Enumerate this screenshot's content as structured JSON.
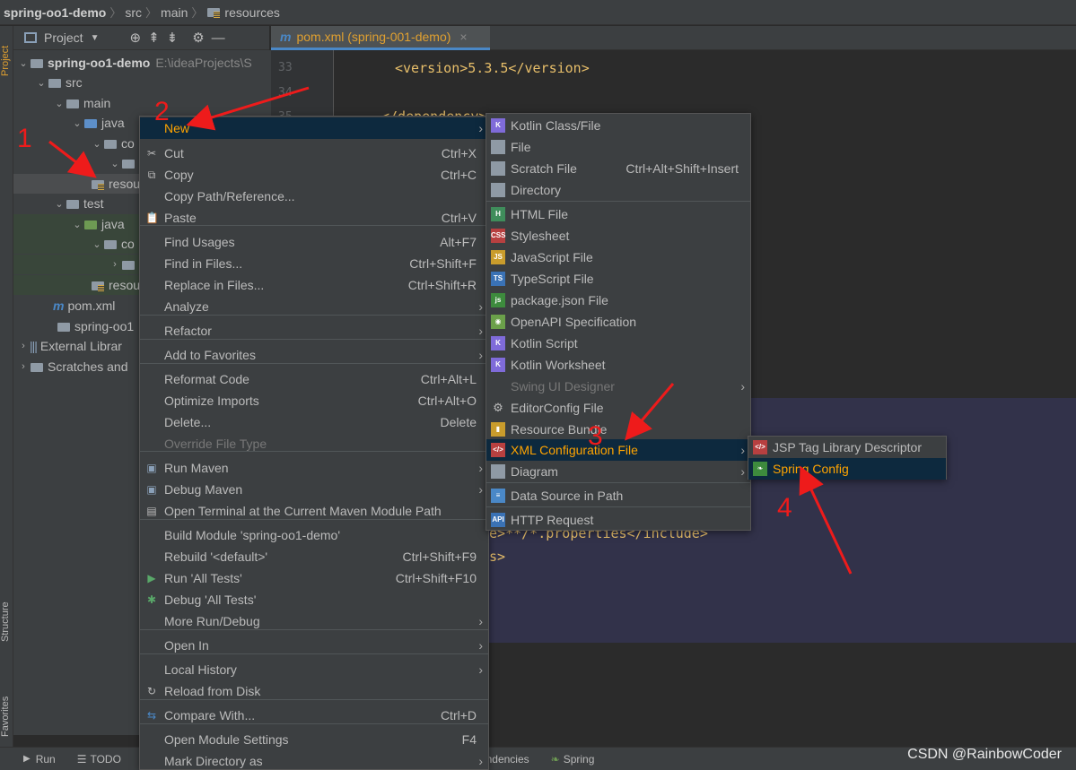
{
  "breadcrumb": {
    "project": "spring-oo1-demo",
    "src": "src",
    "main": "main",
    "resources": "resources"
  },
  "left_strip": {
    "project": "Project",
    "structure": "Structure",
    "favorites": "Favorites"
  },
  "project_toolbar": {
    "label": "Project",
    "caret": "▼"
  },
  "tree": {
    "root": "spring-oo1-demo",
    "root_path": "E:\\ideaProjects\\S",
    "src": "src",
    "main": "main",
    "java": "java",
    "co1": "co",
    "resources": "resou",
    "test": "test",
    "test_java": "java",
    "co2": "co",
    "test_resources": "resou",
    "pom": "pom.xml",
    "iml": "spring-oo1",
    "external": "External Librar",
    "scratches": "Scratches and"
  },
  "editor": {
    "tab_label": "pom.xml (spring-001-demo)",
    "lines": [
      "33",
      "34",
      "35"
    ],
    "line33": "<version>5.3.5</version>",
    "line35_partial": "</dependency>",
    "frag1": "de>**/*.properties</include>",
    "frag2": "es>"
  },
  "context_menu": {
    "items": [
      {
        "label": "New",
        "shortcut": "",
        "submenu": true
      },
      {
        "label": "Cut",
        "shortcut": "Ctrl+X"
      },
      {
        "label": "Copy",
        "shortcut": "Ctrl+C"
      },
      {
        "label": "Copy Path/Reference...",
        "shortcut": ""
      },
      {
        "label": "Paste",
        "shortcut": "Ctrl+V"
      },
      {
        "label": "Find Usages",
        "shortcut": "Alt+F7"
      },
      {
        "label": "Find in Files...",
        "shortcut": "Ctrl+Shift+F"
      },
      {
        "label": "Replace in Files...",
        "shortcut": "Ctrl+Shift+R"
      },
      {
        "label": "Analyze",
        "shortcut": "",
        "submenu": true
      },
      {
        "label": "Refactor",
        "shortcut": "",
        "submenu": true
      },
      {
        "label": "Add to Favorites",
        "shortcut": "",
        "submenu": true
      },
      {
        "label": "Reformat Code",
        "shortcut": "Ctrl+Alt+L"
      },
      {
        "label": "Optimize Imports",
        "shortcut": "Ctrl+Alt+O"
      },
      {
        "label": "Delete...",
        "shortcut": "Delete"
      },
      {
        "label": "Override File Type",
        "shortcut": ""
      },
      {
        "label": "Run Maven",
        "shortcut": "",
        "submenu": true
      },
      {
        "label": "Debug Maven",
        "shortcut": "",
        "submenu": true
      },
      {
        "label": "Open Terminal at the Current Maven Module Path",
        "shortcut": ""
      },
      {
        "label": "Build Module 'spring-oo1-demo'",
        "shortcut": ""
      },
      {
        "label": "Rebuild '<default>'",
        "shortcut": "Ctrl+Shift+F9"
      },
      {
        "label": "Run 'All Tests'",
        "shortcut": "Ctrl+Shift+F10"
      },
      {
        "label": "Debug 'All Tests'",
        "shortcut": ""
      },
      {
        "label": "More Run/Debug",
        "shortcut": "",
        "submenu": true
      },
      {
        "label": "Open In",
        "shortcut": "",
        "submenu": true
      },
      {
        "label": "Local History",
        "shortcut": "",
        "submenu": true
      },
      {
        "label": "Reload from Disk",
        "shortcut": ""
      },
      {
        "label": "Compare With...",
        "shortcut": "Ctrl+D"
      },
      {
        "label": "Open Module Settings",
        "shortcut": "F4"
      },
      {
        "label": "Mark Directory as",
        "shortcut": "",
        "submenu": true
      }
    ]
  },
  "new_submenu": {
    "items": [
      {
        "label": "Kotlin Class/File",
        "shortcut": ""
      },
      {
        "label": "File",
        "shortcut": ""
      },
      {
        "label": "Scratch File",
        "shortcut": "Ctrl+Alt+Shift+Insert"
      },
      {
        "label": "Directory",
        "shortcut": ""
      },
      {
        "label": "HTML File",
        "shortcut": ""
      },
      {
        "label": "Stylesheet",
        "shortcut": ""
      },
      {
        "label": "JavaScript File",
        "shortcut": ""
      },
      {
        "label": "TypeScript File",
        "shortcut": ""
      },
      {
        "label": "package.json File",
        "shortcut": ""
      },
      {
        "label": "OpenAPI Specification",
        "shortcut": ""
      },
      {
        "label": "Kotlin Script",
        "shortcut": ""
      },
      {
        "label": "Kotlin Worksheet",
        "shortcut": ""
      },
      {
        "label": "Swing UI Designer",
        "shortcut": ""
      },
      {
        "label": "EditorConfig File",
        "shortcut": ""
      },
      {
        "label": "Resource Bundle",
        "shortcut": ""
      },
      {
        "label": "XML Configuration File",
        "shortcut": ""
      },
      {
        "label": "Diagram",
        "shortcut": ""
      },
      {
        "label": "Data Source in Path",
        "shortcut": ""
      },
      {
        "label": "HTTP Request",
        "shortcut": ""
      }
    ]
  },
  "xml_submenu": {
    "items": [
      {
        "label": "JSP Tag Library Descriptor"
      },
      {
        "label": "Spring Config"
      }
    ]
  },
  "annotations": {
    "n1": "1",
    "n2": "2",
    "n3": "3",
    "n4": "4"
  },
  "bottom_bar": {
    "run": "Run",
    "todo": "TODO",
    "dependencies": "endencies",
    "spring": "Spring"
  },
  "watermark": "CSDN @RainbowCoder",
  "colors": {
    "highlight_bg": "#0d293e",
    "highlight_text": "#ffa400",
    "annotation": "#ee1b1b",
    "menu_bg": "#3c3f41"
  }
}
